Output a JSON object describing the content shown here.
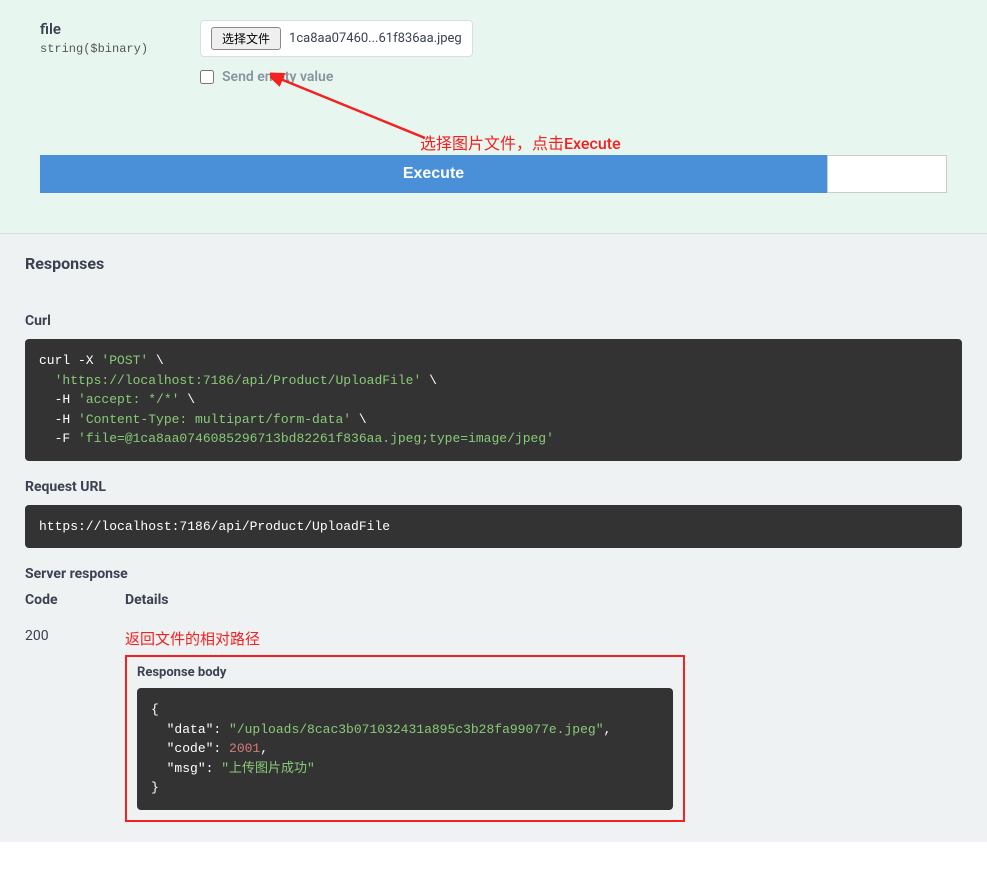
{
  "param": {
    "name": "file",
    "type": "string($binary)",
    "file_button_label": "选择文件",
    "file_name": "1ca8aa07460...61f836aa.jpeg",
    "send_empty_label": "Send empty value"
  },
  "annotations": {
    "select_file": "选择图片文件，点击Execute",
    "return_path": "返回文件的相对路径"
  },
  "execute": {
    "label": "Execute"
  },
  "responses": {
    "heading": "Responses",
    "curl_label": "Curl",
    "curl": {
      "line1_cmd": "curl -X ",
      "line1_str": "'POST'",
      "line1_end": " \\",
      "line2_str": "  'https://localhost:7186/api/Product/UploadFile'",
      "line2_end": " \\",
      "line3_pre": "  -H ",
      "line3_str": "'accept: */*'",
      "line3_end": " \\",
      "line4_pre": "  -H ",
      "line4_str": "'Content-Type: multipart/form-data'",
      "line4_end": " \\",
      "line5_pre": "  -F ",
      "line5_str": "'file=@1ca8aa0746085296713bd82261f836aa.jpeg;type=image/jpeg'"
    },
    "request_url_label": "Request URL",
    "request_url": "https://localhost:7186/api/Product/UploadFile",
    "server_response_label": "Server response",
    "code_header": "Code",
    "details_header": "Details",
    "code_value": "200",
    "response_body_label": "Response body",
    "body": {
      "open": "{",
      "data_key": "\"data\"",
      "data_val": "\"/uploads/8cac3b071032431a895c3b28fa99077e.jpeg\"",
      "code_key": "\"code\"",
      "code_val": "2001",
      "msg_key": "\"msg\"",
      "msg_val": "\"上传图片成功\"",
      "close": "}"
    }
  }
}
